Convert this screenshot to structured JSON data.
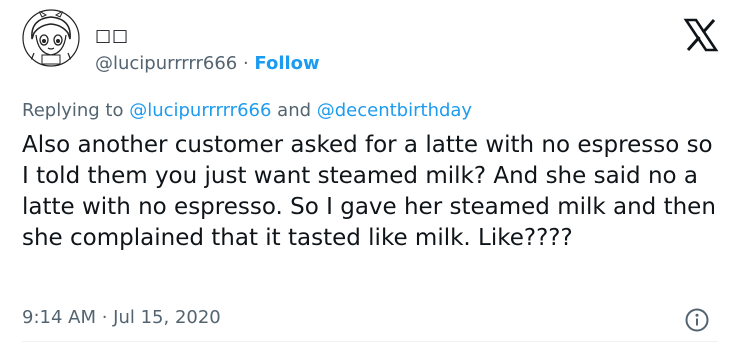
{
  "user": {
    "display_name": "□□",
    "handle": "@lucipurrrrr666",
    "separator": " · ",
    "follow_label": "Follow"
  },
  "reply": {
    "prefix": "Replying to ",
    "first_mention": "@lucipurrrrr666",
    "conjunction": " and ",
    "second_mention": "@decentbirthday"
  },
  "tweet": {
    "text": "Also another customer asked for a latte with no espresso so I told them you just want steamed milk? And she said no a latte with no espresso. So I gave her steamed milk and then she complained that it tasted like milk. Like????",
    "timestamp": "9:14 AM · Jul 15, 2020"
  },
  "icons": {
    "brand": "x-logo-icon",
    "avatar": "anime-avatar",
    "info": "info-icon"
  },
  "colors": {
    "text": "#0f1419",
    "muted": "#536471",
    "link": "#1d9bf0",
    "divider": "#eff3f4"
  }
}
